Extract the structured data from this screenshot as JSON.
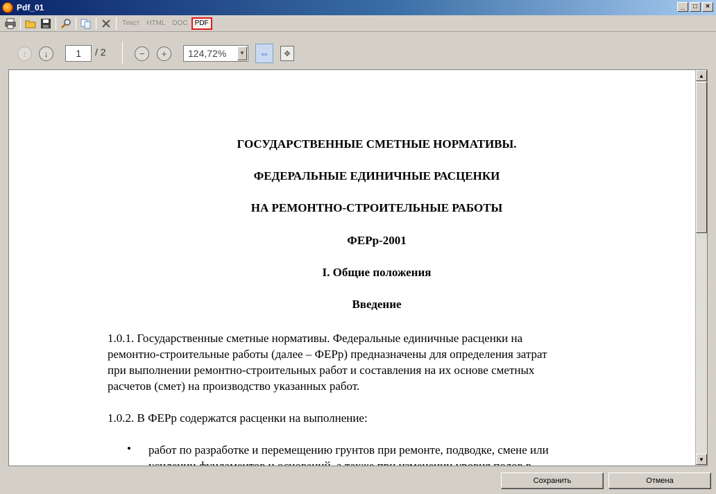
{
  "window": {
    "title": "Pdf_01"
  },
  "toolbar": {
    "icons": [
      "print-icon",
      "open-folder-icon",
      "save-icon",
      "search-icon",
      "copy-icon",
      "cut-icon"
    ],
    "formats": [
      "Текст",
      "HTML",
      "DOC",
      "PDF"
    ],
    "active_format": "PDF"
  },
  "viewer": {
    "current_page": "1",
    "total_pages": "/ 2",
    "zoom": "124,72%"
  },
  "document": {
    "headings": [
      "ГОСУДАРСТВЕННЫЕ СМЕТНЫЕ НОРМАТИВЫ.",
      "ФЕДЕРАЛЬНЫЕ ЕДИНИЧНЫЕ РАСЦЕНКИ",
      "НА РЕМОНТНО-СТРОИТЕЛЬНЫЕ РАБОТЫ",
      "ФЕРр-2001",
      "I. Общие положения",
      "Введение"
    ],
    "paragraph1_lines": [
      "1.0.1. Государственные сметные нормативы. Федеральные единичные расценки на",
      "ремонтно-строительные работы (далее – ФЕРр) предназначены для определения затрат",
      "при выполнении ремонтно-строительных работ и составления на их основе сметных",
      "расчетов (смет) на производство указанных работ."
    ],
    "paragraph2": "1.0.2. В ФЕРр содержатся расценки на выполнение:",
    "bullet_lines": [
      "работ по разработке и перемещению грунтов при ремонте, подводке, смене или",
      "усилении фундаментов и оснований, а также при изменении уровня полов в"
    ]
  },
  "buttons": {
    "save": "Сохранить",
    "cancel": "Отмена"
  },
  "colors": {
    "title_bar_start": "#0a246a",
    "title_bar_end": "#a6caf0",
    "active_format_border": "#e21b1b"
  }
}
